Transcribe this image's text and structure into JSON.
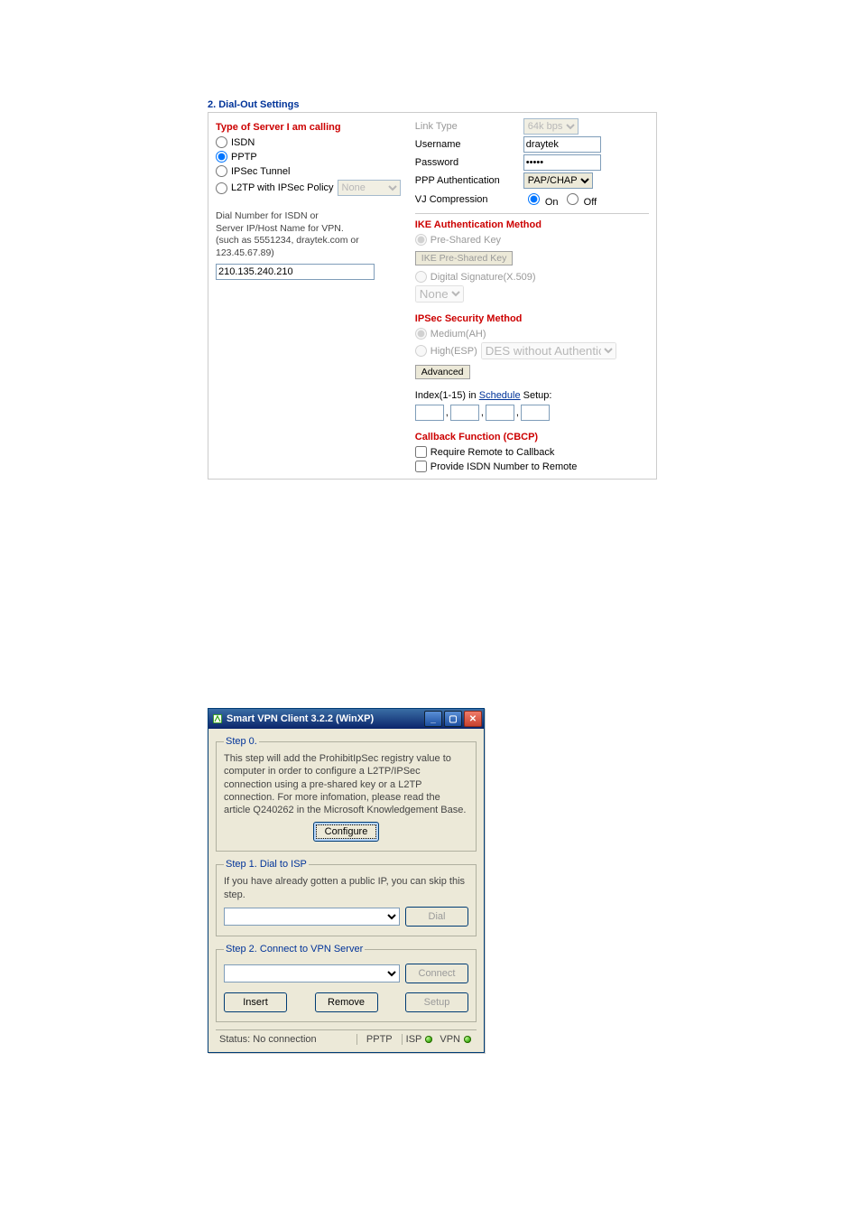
{
  "dialout": {
    "heading": "2. Dial-Out Settings",
    "server_type_label": "Type of Server I am calling",
    "types": {
      "isdn": "ISDN",
      "pptp": "PPTP",
      "ipsec": "IPSec Tunnel",
      "l2tp": "L2TP with IPSec Policy",
      "l2tp_policy": "None"
    },
    "note_line1": "Dial Number for ISDN or",
    "note_line2": "Server IP/Host Name for VPN.",
    "note_line3": "(such as 5551234, draytek.com or 123.45.67.89)",
    "ip_value": "210.135.240.210",
    "right": {
      "link_type": {
        "label": "Link Type",
        "value": "64k bps"
      },
      "username": {
        "label": "Username",
        "value": "draytek"
      },
      "password": {
        "label": "Password",
        "value": "•••••"
      },
      "ppp_auth": {
        "label": "PPP Authentication",
        "value": "PAP/CHAP"
      },
      "vj": {
        "label": "VJ Compression",
        "on": "On",
        "off": "Off"
      }
    },
    "ike": {
      "heading": "IKE Authentication Method",
      "psk": "Pre-Shared Key",
      "psk_btn": "IKE Pre-Shared Key",
      "sig": "Digital Signature(X.509)",
      "sig_value": "None"
    },
    "ipsec_sec": {
      "heading": "IPSec Security Method",
      "medium": "Medium(AH)",
      "high": "High(ESP)",
      "high_value": "DES without Authentication",
      "adv_btn": "Advanced"
    },
    "schedule": {
      "prefix": "Index(1-15) in ",
      "link": "Schedule",
      "suffix": " Setup:"
    },
    "callback": {
      "heading": "Callback Function (CBCP)",
      "opt1": "Require Remote to Callback",
      "opt2": "Provide ISDN Number to Remote"
    }
  },
  "vpnclient": {
    "title": "Smart VPN Client  3.2.2 (WinXP)",
    "step0": {
      "legend": "Step 0.",
      "text": "This step will add the ProhibitIpSec registry value to computer in order to configure a L2TP/IPSec connection using a pre-shared key or a L2TP connection. For more infomation, please read the article Q240262 in the Microsoft Knowledgement Base.",
      "btn": "Configure"
    },
    "step1": {
      "legend": "Step 1. Dial to ISP",
      "text": "If you have already gotten a public IP, you can skip this step.",
      "btn": "Dial"
    },
    "step2": {
      "legend": "Step 2. Connect to VPN Server",
      "btn_connect": "Connect",
      "btn_insert": "Insert",
      "btn_remove": "Remove",
      "btn_setup": "Setup"
    },
    "status": {
      "label": "Status: No connection",
      "proto": "PPTP",
      "isp": "ISP",
      "vpn": "VPN"
    }
  }
}
